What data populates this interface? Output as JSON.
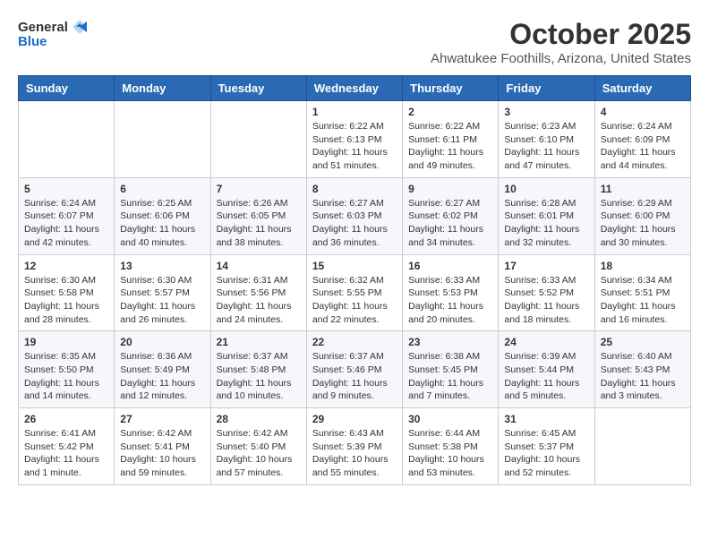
{
  "logo": {
    "general": "General",
    "blue": "Blue"
  },
  "title": "October 2025",
  "location": "Ahwatukee Foothills, Arizona, United States",
  "headers": [
    "Sunday",
    "Monday",
    "Tuesday",
    "Wednesday",
    "Thursday",
    "Friday",
    "Saturday"
  ],
  "weeks": [
    [
      {
        "day": "",
        "info": ""
      },
      {
        "day": "",
        "info": ""
      },
      {
        "day": "",
        "info": ""
      },
      {
        "day": "1",
        "info": "Sunrise: 6:22 AM\nSunset: 6:13 PM\nDaylight: 11 hours\nand 51 minutes."
      },
      {
        "day": "2",
        "info": "Sunrise: 6:22 AM\nSunset: 6:11 PM\nDaylight: 11 hours\nand 49 minutes."
      },
      {
        "day": "3",
        "info": "Sunrise: 6:23 AM\nSunset: 6:10 PM\nDaylight: 11 hours\nand 47 minutes."
      },
      {
        "day": "4",
        "info": "Sunrise: 6:24 AM\nSunset: 6:09 PM\nDaylight: 11 hours\nand 44 minutes."
      }
    ],
    [
      {
        "day": "5",
        "info": "Sunrise: 6:24 AM\nSunset: 6:07 PM\nDaylight: 11 hours\nand 42 minutes."
      },
      {
        "day": "6",
        "info": "Sunrise: 6:25 AM\nSunset: 6:06 PM\nDaylight: 11 hours\nand 40 minutes."
      },
      {
        "day": "7",
        "info": "Sunrise: 6:26 AM\nSunset: 6:05 PM\nDaylight: 11 hours\nand 38 minutes."
      },
      {
        "day": "8",
        "info": "Sunrise: 6:27 AM\nSunset: 6:03 PM\nDaylight: 11 hours\nand 36 minutes."
      },
      {
        "day": "9",
        "info": "Sunrise: 6:27 AM\nSunset: 6:02 PM\nDaylight: 11 hours\nand 34 minutes."
      },
      {
        "day": "10",
        "info": "Sunrise: 6:28 AM\nSunset: 6:01 PM\nDaylight: 11 hours\nand 32 minutes."
      },
      {
        "day": "11",
        "info": "Sunrise: 6:29 AM\nSunset: 6:00 PM\nDaylight: 11 hours\nand 30 minutes."
      }
    ],
    [
      {
        "day": "12",
        "info": "Sunrise: 6:30 AM\nSunset: 5:58 PM\nDaylight: 11 hours\nand 28 minutes."
      },
      {
        "day": "13",
        "info": "Sunrise: 6:30 AM\nSunset: 5:57 PM\nDaylight: 11 hours\nand 26 minutes."
      },
      {
        "day": "14",
        "info": "Sunrise: 6:31 AM\nSunset: 5:56 PM\nDaylight: 11 hours\nand 24 minutes."
      },
      {
        "day": "15",
        "info": "Sunrise: 6:32 AM\nSunset: 5:55 PM\nDaylight: 11 hours\nand 22 minutes."
      },
      {
        "day": "16",
        "info": "Sunrise: 6:33 AM\nSunset: 5:53 PM\nDaylight: 11 hours\nand 20 minutes."
      },
      {
        "day": "17",
        "info": "Sunrise: 6:33 AM\nSunset: 5:52 PM\nDaylight: 11 hours\nand 18 minutes."
      },
      {
        "day": "18",
        "info": "Sunrise: 6:34 AM\nSunset: 5:51 PM\nDaylight: 11 hours\nand 16 minutes."
      }
    ],
    [
      {
        "day": "19",
        "info": "Sunrise: 6:35 AM\nSunset: 5:50 PM\nDaylight: 11 hours\nand 14 minutes."
      },
      {
        "day": "20",
        "info": "Sunrise: 6:36 AM\nSunset: 5:49 PM\nDaylight: 11 hours\nand 12 minutes."
      },
      {
        "day": "21",
        "info": "Sunrise: 6:37 AM\nSunset: 5:48 PM\nDaylight: 11 hours\nand 10 minutes."
      },
      {
        "day": "22",
        "info": "Sunrise: 6:37 AM\nSunset: 5:46 PM\nDaylight: 11 hours\nand 9 minutes."
      },
      {
        "day": "23",
        "info": "Sunrise: 6:38 AM\nSunset: 5:45 PM\nDaylight: 11 hours\nand 7 minutes."
      },
      {
        "day": "24",
        "info": "Sunrise: 6:39 AM\nSunset: 5:44 PM\nDaylight: 11 hours\nand 5 minutes."
      },
      {
        "day": "25",
        "info": "Sunrise: 6:40 AM\nSunset: 5:43 PM\nDaylight: 11 hours\nand 3 minutes."
      }
    ],
    [
      {
        "day": "26",
        "info": "Sunrise: 6:41 AM\nSunset: 5:42 PM\nDaylight: 11 hours\nand 1 minute."
      },
      {
        "day": "27",
        "info": "Sunrise: 6:42 AM\nSunset: 5:41 PM\nDaylight: 10 hours\nand 59 minutes."
      },
      {
        "day": "28",
        "info": "Sunrise: 6:42 AM\nSunset: 5:40 PM\nDaylight: 10 hours\nand 57 minutes."
      },
      {
        "day": "29",
        "info": "Sunrise: 6:43 AM\nSunset: 5:39 PM\nDaylight: 10 hours\nand 55 minutes."
      },
      {
        "day": "30",
        "info": "Sunrise: 6:44 AM\nSunset: 5:38 PM\nDaylight: 10 hours\nand 53 minutes."
      },
      {
        "day": "31",
        "info": "Sunrise: 6:45 AM\nSunset: 5:37 PM\nDaylight: 10 hours\nand 52 minutes."
      },
      {
        "day": "",
        "info": ""
      }
    ]
  ]
}
